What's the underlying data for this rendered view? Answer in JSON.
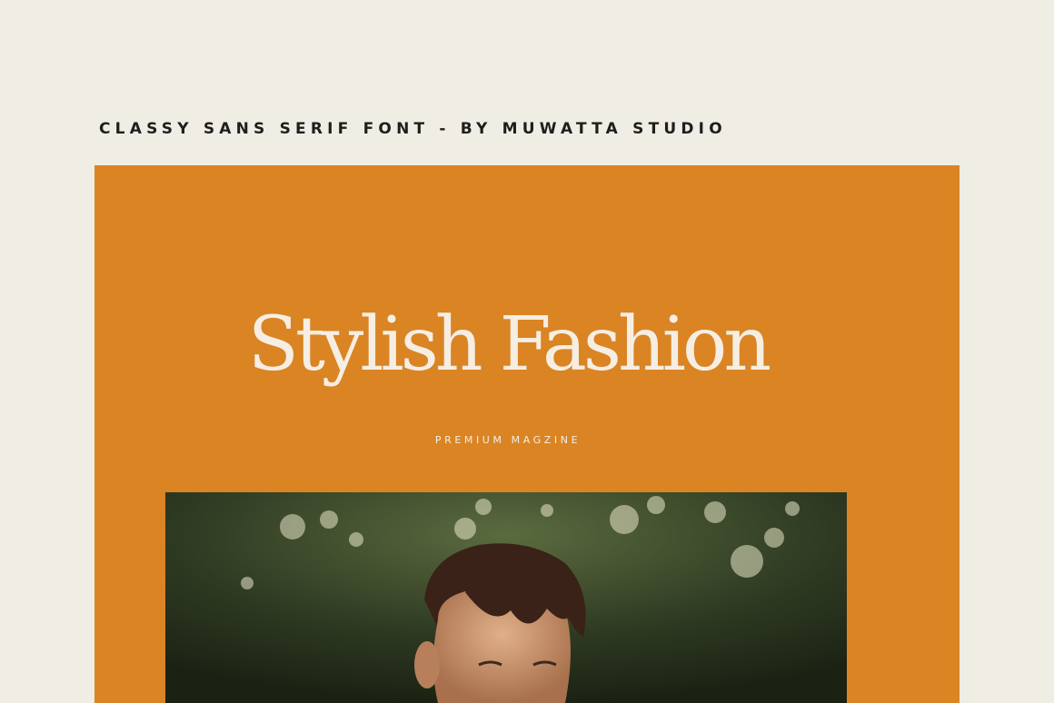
{
  "top_caption": "CLASSY SANS SERIF FONT - BY MUWATTA STUDIO",
  "poster": {
    "headline": "Stylish Fashion",
    "subline": "PREMIUM MAGZINE",
    "background": "#da8424",
    "text_color": "#f6eee2"
  },
  "page_background": "#f0ede4"
}
